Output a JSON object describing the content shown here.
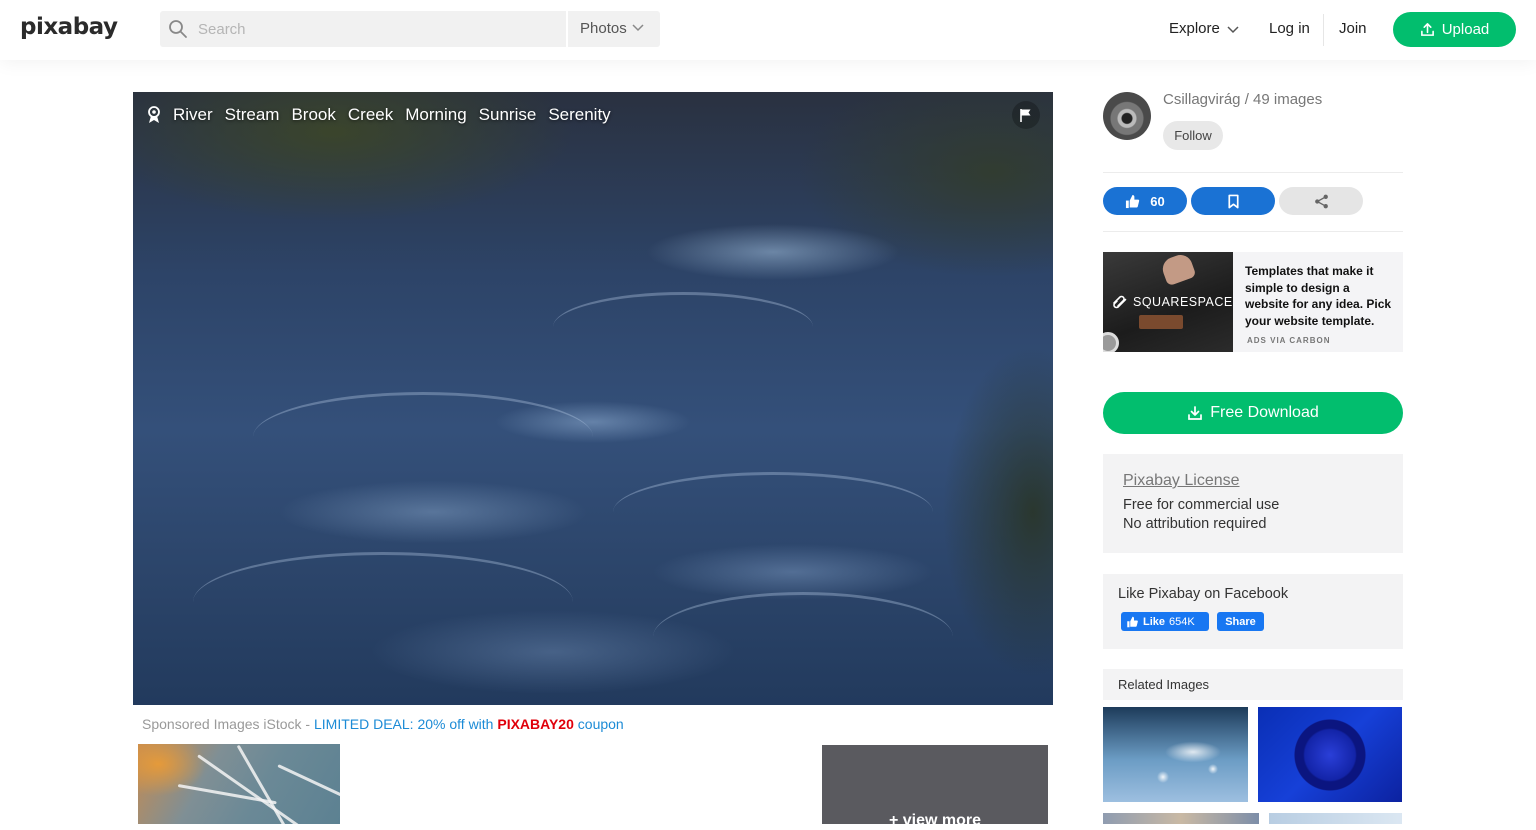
{
  "header": {
    "logo": "pixabay",
    "search": {
      "placeholder": "Search",
      "value": "",
      "type_selected": "Photos"
    },
    "nav": {
      "explore": "Explore",
      "login": "Log in",
      "join": "Join",
      "upload": "Upload"
    }
  },
  "photo": {
    "tags": [
      "River",
      "Stream",
      "Brook",
      "Creek",
      "Morning",
      "Sunrise",
      "Serenity"
    ],
    "icons": {
      "badge": "award-icon",
      "flag": "flag-icon"
    }
  },
  "sponsored": {
    "prefix": "Sponsored Images iStock - ",
    "deal": "LIMITED DEAL: 20% off with ",
    "code": "PIXABAY20",
    "suffix": " coupon",
    "view_more": "+ view more"
  },
  "author": {
    "name_line": "Csillagvirág / 49 images",
    "follow": "Follow"
  },
  "actions": {
    "likes": "60"
  },
  "ad": {
    "brand": "SQUARESPACE",
    "text": "Templates that make it simple to design a website for any idea. Pick your website template.",
    "via": "ADS VIA CARBON"
  },
  "download": {
    "label": "Free Download"
  },
  "license": {
    "title": "Pixabay License",
    "line1": "Free for commercial use",
    "line2": "No attribution required"
  },
  "facebook": {
    "title": "Like Pixabay on Facebook",
    "like_label": "Like",
    "like_count": "654K",
    "share_label": "Share"
  },
  "related": {
    "title": "Related Images"
  },
  "colors": {
    "green": "#02be6e",
    "blue": "#1a72d4",
    "facebook": "#1877f2",
    "deal": "#1c8bd6",
    "code": "#e0000b"
  }
}
